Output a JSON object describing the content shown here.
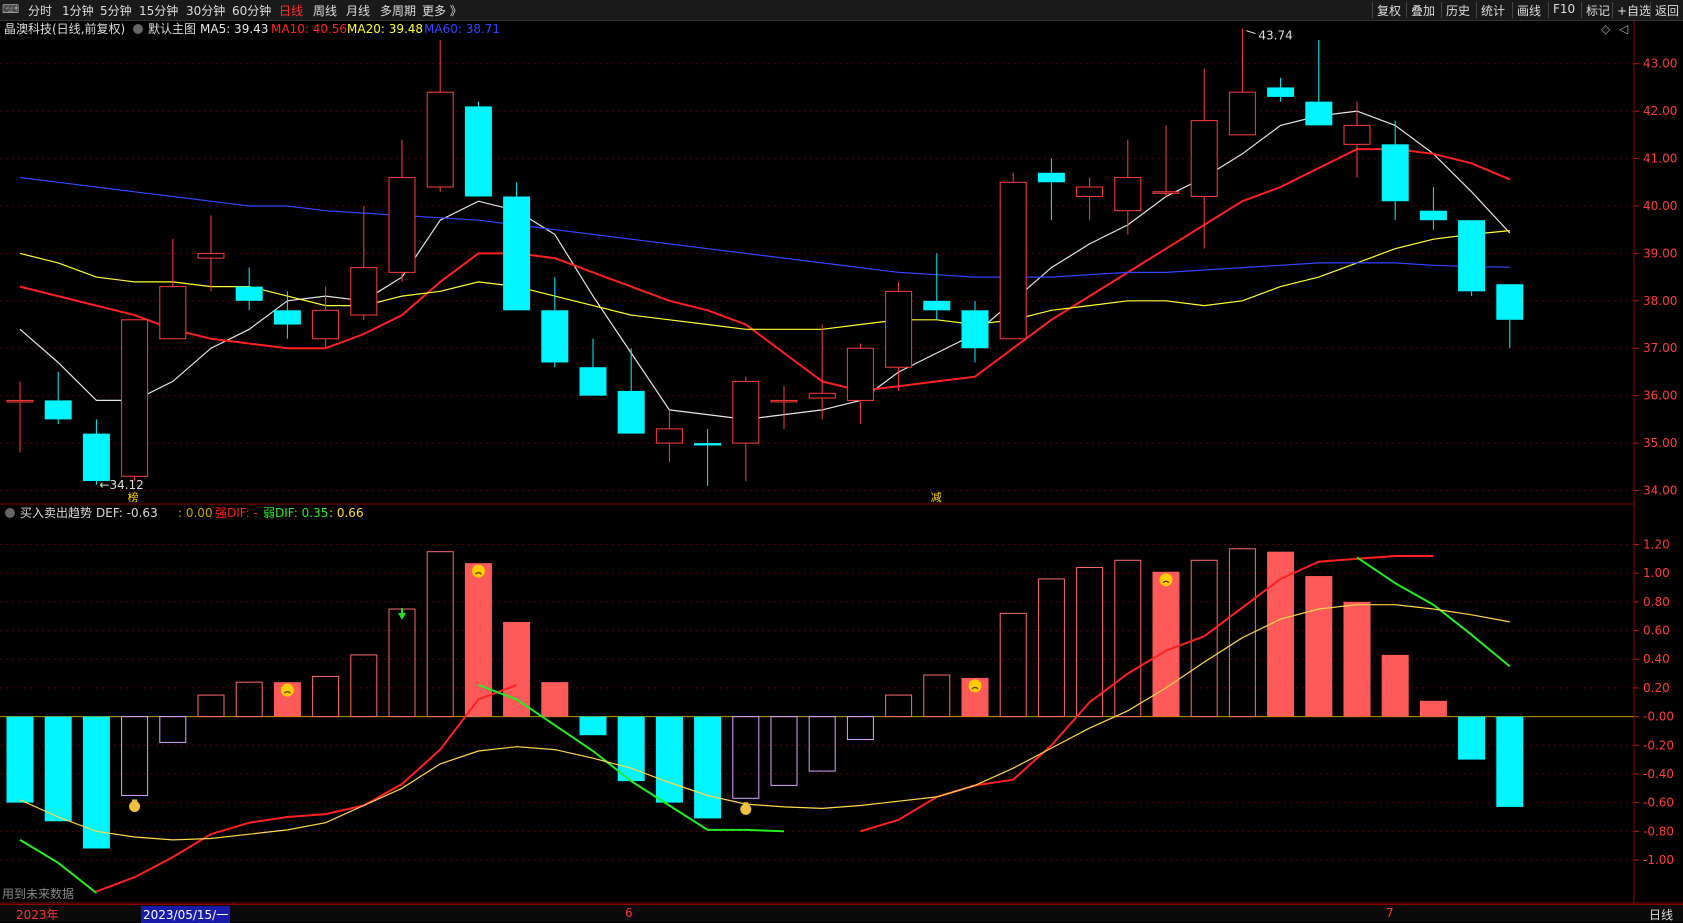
{
  "toolbar": {
    "left": [
      "分时",
      "1分钟",
      "5分钟",
      "15分钟",
      "30分钟",
      "60分钟",
      "日线",
      "周线",
      "月线",
      "多周期",
      "更多 》"
    ],
    "active_index": 6,
    "right": [
      "复权",
      "叠加",
      "历史",
      "统计",
      "画线",
      "F10",
      "标记",
      "+自选",
      "返回"
    ]
  },
  "main_header": {
    "name": "晶澳科技(日线,前复权)",
    "theme": "默认主图",
    "ma": [
      {
        "label": "MA5: 39.43",
        "color": "#e6e6e6"
      },
      {
        "label": "MA10: 40.56",
        "color": "#ff2020"
      },
      {
        "label": "MA20: 39.48",
        "color": "#ffff33"
      },
      {
        "label": "MA60: 38.71",
        "color": "#3344ff"
      }
    ]
  },
  "sub_header": {
    "name": "买入卖出趋势",
    "items": [
      {
        "label": "DEF: -0.63",
        "color": "#dddddd"
      },
      {
        "label": ": 0.00",
        "color": "#c8a800"
      },
      {
        "label": "强DIF: -",
        "color": "#ff2020"
      },
      {
        "label": "弱DIF: 0.35",
        "color": "#22ee22"
      },
      {
        "label": ": 0.66",
        "color": "#ffd84a"
      }
    ]
  },
  "bottom": {
    "note": "用到未来数据",
    "year": "2023年",
    "date": "2023/05/15/一",
    "m6": "6",
    "m7": "7",
    "period": "日线"
  },
  "markers": {
    "bang": "榜",
    "jian": "减",
    "high_label": "43.74",
    "low_label": "34.12"
  },
  "chart_data": [
    {
      "type": "candlestick",
      "ylim": [
        33.8,
        43.5
      ],
      "yticks": [
        "34.00",
        "35.00",
        "36.00",
        "37.00",
        "38.00",
        "39.00",
        "40.00",
        "41.00",
        "42.00",
        "43.00"
      ],
      "colors": {
        "up": "#ff3c3c",
        "down": "#00f5ff"
      },
      "candles": [
        {
          "o": 35.9,
          "h": 36.3,
          "l": 34.8,
          "c": 35.9
        },
        {
          "o": 35.9,
          "h": 36.5,
          "l": 35.4,
          "c": 35.5
        },
        {
          "o": 35.2,
          "h": 35.5,
          "l": 34.12,
          "c": 34.2
        },
        {
          "o": 34.3,
          "h": 37.6,
          "l": 34.2,
          "c": 37.6
        },
        {
          "o": 37.2,
          "h": 39.3,
          "l": 37.2,
          "c": 38.3
        },
        {
          "o": 38.9,
          "h": 39.8,
          "l": 38.2,
          "c": 39.0
        },
        {
          "o": 38.3,
          "h": 38.7,
          "l": 37.8,
          "c": 38.0
        },
        {
          "o": 37.8,
          "h": 38.2,
          "l": 37.2,
          "c": 37.5
        },
        {
          "o": 37.2,
          "h": 38.3,
          "l": 37.0,
          "c": 37.8
        },
        {
          "o": 37.7,
          "h": 40.0,
          "l": 37.6,
          "c": 38.7
        },
        {
          "o": 38.6,
          "h": 41.4,
          "l": 38.4,
          "c": 40.6
        },
        {
          "o": 40.4,
          "h": 43.5,
          "l": 40.3,
          "c": 42.4
        },
        {
          "o": 42.1,
          "h": 42.2,
          "l": 40.2,
          "c": 40.2
        },
        {
          "o": 40.2,
          "h": 40.5,
          "l": 37.8,
          "c": 37.8
        },
        {
          "o": 37.8,
          "h": 38.5,
          "l": 36.6,
          "c": 36.7
        },
        {
          "o": 36.6,
          "h": 37.2,
          "l": 36.0,
          "c": 36.0
        },
        {
          "o": 36.1,
          "h": 37.0,
          "l": 35.2,
          "c": 35.2
        },
        {
          "o": 35.0,
          "h": 35.7,
          "l": 34.6,
          "c": 35.3
        },
        {
          "o": 35.0,
          "h": 35.3,
          "l": 34.1,
          "c": 34.95
        },
        {
          "o": 35.0,
          "h": 36.4,
          "l": 34.2,
          "c": 36.3
        },
        {
          "o": 35.9,
          "h": 36.2,
          "l": 35.3,
          "c": 35.9
        },
        {
          "o": 35.95,
          "h": 37.5,
          "l": 35.5,
          "c": 36.05
        },
        {
          "o": 35.9,
          "h": 37.1,
          "l": 35.4,
          "c": 37.0
        },
        {
          "o": 36.6,
          "h": 38.4,
          "l": 36.1,
          "c": 38.2
        },
        {
          "o": 38.0,
          "h": 39.0,
          "l": 37.6,
          "c": 37.8
        },
        {
          "o": 37.8,
          "h": 38.0,
          "l": 36.7,
          "c": 37.0
        },
        {
          "o": 37.2,
          "h": 40.7,
          "l": 37.2,
          "c": 40.5
        },
        {
          "o": 40.7,
          "h": 41.0,
          "l": 39.7,
          "c": 40.5
        },
        {
          "o": 40.2,
          "h": 40.6,
          "l": 39.7,
          "c": 40.4
        },
        {
          "o": 39.9,
          "h": 41.4,
          "l": 39.4,
          "c": 40.6
        },
        {
          "o": 40.3,
          "h": 41.7,
          "l": 40.2,
          "c": 40.3
        },
        {
          "o": 40.2,
          "h": 42.9,
          "l": 39.1,
          "c": 41.8
        },
        {
          "o": 41.5,
          "h": 43.74,
          "l": 41.5,
          "c": 42.4
        },
        {
          "o": 42.5,
          "h": 42.7,
          "l": 42.2,
          "c": 42.3
        },
        {
          "o": 42.2,
          "h": 43.5,
          "l": 41.7,
          "c": 41.7
        },
        {
          "o": 41.3,
          "h": 42.2,
          "l": 40.6,
          "c": 41.7
        },
        {
          "o": 41.3,
          "h": 41.8,
          "l": 39.7,
          "c": 40.1
        },
        {
          "o": 39.9,
          "h": 40.4,
          "l": 39.5,
          "c": 39.7
        },
        {
          "o": 39.7,
          "h": 39.7,
          "l": 38.1,
          "c": 38.2
        },
        {
          "o": 38.35,
          "h": 38.35,
          "l": 37.0,
          "c": 37.6
        }
      ],
      "ma": [
        {
          "name": "MA5",
          "color": "#e6e6e6",
          "start": 0,
          "values": [
            37.4,
            36.7,
            35.9,
            35.9,
            36.3,
            37.0,
            37.4,
            38.0,
            38.1,
            38.0,
            38.5,
            39.7,
            40.1,
            39.9,
            39.4,
            38.1,
            36.9,
            35.7,
            35.6,
            35.5,
            35.6,
            35.7,
            35.9,
            36.5,
            36.9,
            37.3,
            38.0,
            38.7,
            39.2,
            39.6,
            40.2,
            40.6,
            41.1,
            41.7,
            41.9,
            42.0,
            41.7,
            41.1,
            40.3,
            39.43
          ]
        },
        {
          "name": "MA10",
          "color": "#ff2020",
          "start": 0,
          "values": [
            38.3,
            38.1,
            37.9,
            37.7,
            37.4,
            37.2,
            37.1,
            37.0,
            37.0,
            37.3,
            37.7,
            38.4,
            39.0,
            39.0,
            38.9,
            38.6,
            38.3,
            38.0,
            37.8,
            37.5,
            36.9,
            36.3,
            36.1,
            36.2,
            36.3,
            36.4,
            37.0,
            37.6,
            38.1,
            38.6,
            39.1,
            39.6,
            40.1,
            40.4,
            40.8,
            41.2,
            41.2,
            41.1,
            40.9,
            40.56
          ]
        },
        {
          "name": "MA20",
          "color": "#ffff33",
          "start": 0,
          "values": [
            39.0,
            38.8,
            38.5,
            38.4,
            38.4,
            38.3,
            38.3,
            38.1,
            37.9,
            37.9,
            38.1,
            38.2,
            38.4,
            38.3,
            38.1,
            37.9,
            37.7,
            37.6,
            37.5,
            37.4,
            37.4,
            37.4,
            37.5,
            37.6,
            37.6,
            37.5,
            37.6,
            37.8,
            37.9,
            38.0,
            38.0,
            37.9,
            38.0,
            38.3,
            38.5,
            38.8,
            39.1,
            39.3,
            39.4,
            39.48
          ]
        },
        {
          "name": "MA60",
          "color": "#3344ff",
          "start": 0,
          "values": [
            40.6,
            40.5,
            40.4,
            40.3,
            40.2,
            40.1,
            40.0,
            40.0,
            39.9,
            39.85,
            39.8,
            39.75,
            39.7,
            39.6,
            39.5,
            39.4,
            39.3,
            39.2,
            39.1,
            39.0,
            38.9,
            38.8,
            38.7,
            38.6,
            38.55,
            38.5,
            38.5,
            38.5,
            38.55,
            38.6,
            38.6,
            38.65,
            38.7,
            38.75,
            38.8,
            38.8,
            38.8,
            38.75,
            38.72,
            38.71
          ]
        }
      ]
    },
    {
      "type": "bar",
      "ylim": [
        -1.3,
        1.35
      ],
      "yticks": [
        "1.20",
        "1.00",
        "0.80",
        "0.60",
        "0.40",
        "0.20",
        "-0.00",
        "-0.20",
        "-0.40",
        "-0.60",
        "-0.80",
        "-1.00"
      ],
      "values": [
        -0.6,
        -0.73,
        -0.92,
        -0.55,
        -0.18,
        0.15,
        0.24,
        0.24,
        0.28,
        0.43,
        0.75,
        1.15,
        1.07,
        0.66,
        0.24,
        -0.13,
        -0.45,
        -0.6,
        -0.71,
        -0.57,
        -0.48,
        -0.38,
        -0.16,
        0.15,
        0.29,
        0.27,
        0.72,
        0.96,
        1.04,
        1.09,
        1.01,
        1.09,
        1.17,
        1.15,
        0.98,
        0.8,
        0.43,
        0.11,
        -0.3,
        -0.63
      ],
      "styles": [
        "cyan",
        "cyan",
        "cyan",
        "hollow-purple",
        "hollow-purple",
        "hollow-red",
        "hollow-red",
        "filled-red",
        "hollow-red",
        "hollow-red",
        "hollow-red",
        "hollow-red",
        "filled-red",
        "filled-red",
        "filled-red",
        "cyan",
        "cyan",
        "cyan",
        "cyan",
        "hollow-purple",
        "hollow-purple",
        "hollow-purple",
        "hollow-purple",
        "hollow-red",
        "hollow-red",
        "filled-red",
        "hollow-red",
        "hollow-red",
        "hollow-red",
        "hollow-red",
        "filled-red",
        "hollow-red",
        "hollow-red",
        "filled-red",
        "filled-red",
        "filled-red",
        "filled-red",
        "filled-red",
        "cyan",
        "cyan"
      ],
      "lines": [
        {
          "name": "强DIF",
          "color": "#ff2020",
          "start": 2,
          "values": [
            -1.22,
            -1.12,
            -0.98,
            -0.82,
            -0.74,
            -0.7,
            -0.68,
            -0.62,
            -0.47,
            -0.23,
            0.12,
            0.22,
            null,
            null,
            null,
            null,
            null,
            null,
            null,
            null,
            -0.8,
            -0.72,
            -0.56,
            -0.48,
            -0.44,
            -0.2,
            0.1,
            0.3,
            0.46,
            0.56,
            0.76,
            0.96,
            1.08,
            1.1,
            1.12,
            1.12
          ]
        },
        {
          "name": "弱DIF",
          "color": "#22ee22",
          "start": 0,
          "values": [
            -0.86,
            -1.02,
            -1.23,
            null,
            null,
            null,
            null,
            null,
            null,
            null,
            null,
            null,
            0.22,
            0.12,
            -0.06,
            -0.24,
            -0.45,
            -0.62,
            -0.79,
            -0.79,
            -0.8,
            null,
            null,
            null,
            null,
            null,
            null,
            null,
            null,
            null,
            null,
            null,
            null,
            null,
            null,
            1.11,
            0.93,
            0.78,
            0.57,
            0.35
          ]
        },
        {
          "name": "line",
          "color": "#ffd84a",
          "start": 0,
          "values": [
            -0.58,
            -0.7,
            -0.8,
            -0.84,
            -0.86,
            -0.85,
            -0.82,
            -0.79,
            -0.74,
            -0.62,
            -0.5,
            -0.33,
            -0.24,
            -0.21,
            -0.23,
            -0.29,
            -0.36,
            -0.46,
            -0.55,
            -0.61,
            -0.63,
            -0.64,
            -0.62,
            -0.59,
            -0.56,
            -0.48,
            -0.36,
            -0.22,
            -0.08,
            0.04,
            0.2,
            0.38,
            0.55,
            0.68,
            0.75,
            0.78,
            0.78,
            0.75,
            0.71,
            0.66
          ]
        }
      ]
    }
  ]
}
